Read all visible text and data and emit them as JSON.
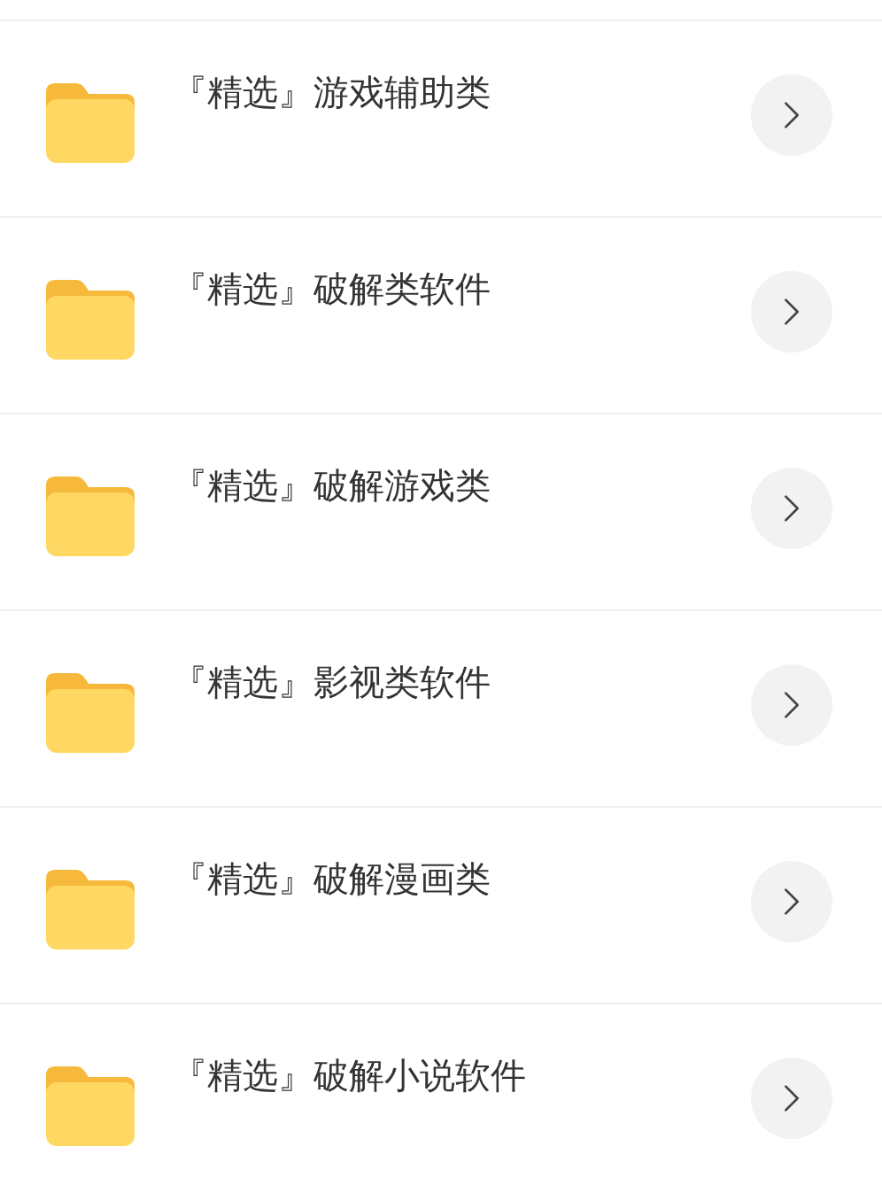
{
  "folders": [
    {
      "name": "『精选』游戏辅助类"
    },
    {
      "name": "『精选』破解类软件"
    },
    {
      "name": "『精选』破解游戏类"
    },
    {
      "name": "『精选』影视类软件"
    },
    {
      "name": "『精选』破解漫画类"
    },
    {
      "name": "『精选』破解小说软件"
    }
  ]
}
